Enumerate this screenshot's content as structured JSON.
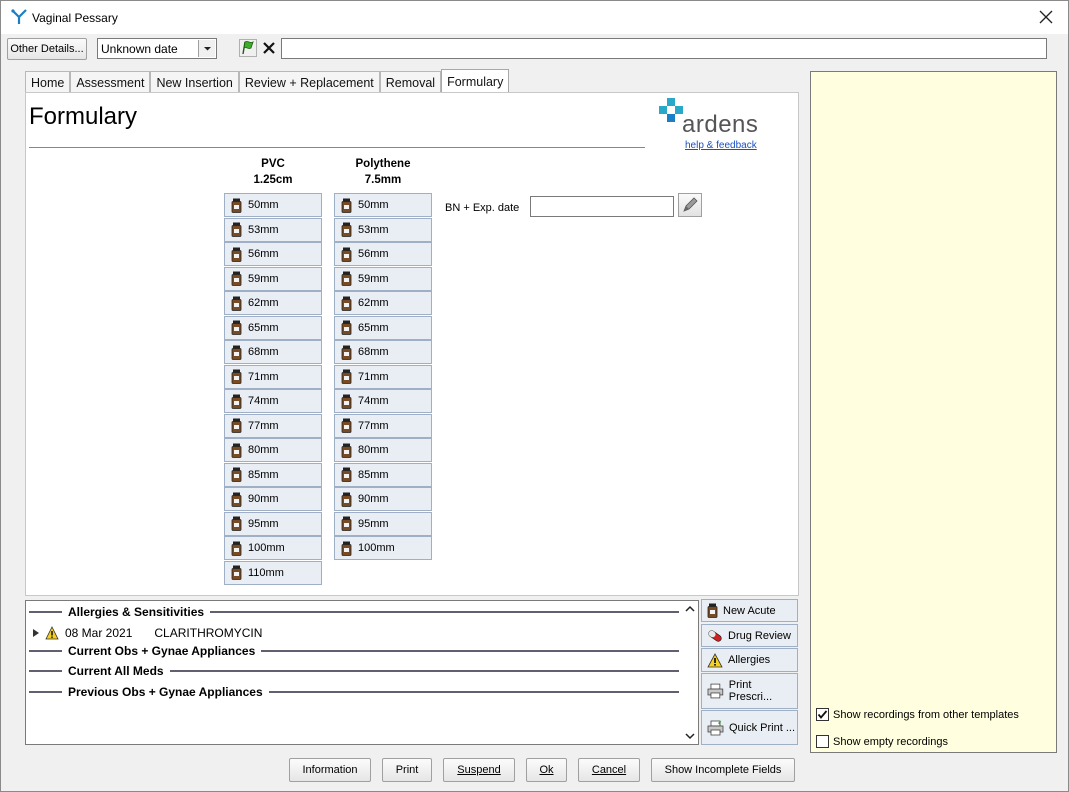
{
  "window": {
    "title": "Vaginal Pessary"
  },
  "toolbar": {
    "other_details_label": "Other Details...",
    "date_value": "Unknown date",
    "note_value": ""
  },
  "tabs": [
    "Home",
    "Assessment",
    "New Insertion",
    "Review + Replacement",
    "Removal",
    "Formulary"
  ],
  "active_tab": "Formulary",
  "page": {
    "title": "Formulary",
    "logo_text": "ardens",
    "help_link": "help & feedback",
    "bn_label": "BN + Exp. date",
    "bn_value": ""
  },
  "pvc": {
    "heading_line1": "PVC",
    "heading_line2": "1.25cm",
    "sizes": [
      "50mm",
      "53mm",
      "56mm",
      "59mm",
      "62mm",
      "65mm",
      "68mm",
      "71mm",
      "74mm",
      "77mm",
      "80mm",
      "85mm",
      "90mm",
      "95mm",
      "100mm",
      "110mm"
    ]
  },
  "polythene": {
    "heading_line1": "Polythene",
    "heading_line2": "7.5mm",
    "sizes": [
      "50mm",
      "53mm",
      "56mm",
      "59mm",
      "62mm",
      "65mm",
      "68mm",
      "71mm",
      "74mm",
      "77mm",
      "80mm",
      "85mm",
      "90mm",
      "95mm",
      "100mm"
    ]
  },
  "summary": {
    "allergies_header": "Allergies & Sensitivities",
    "allergy_date": "08 Mar 2021",
    "allergy_drug": "CLARITHROMYCIN",
    "current_obs_header": "Current Obs + Gynae Appliances",
    "current_meds_header": "Current All Meds",
    "previous_obs_header": "Previous Obs + Gynae Appliances"
  },
  "side_buttons": {
    "new_acute": "New Acute",
    "drug_review": "Drug Review",
    "allergies": "Allergies",
    "print_prescription": "Print Prescri...",
    "quick_print": "Quick Print ..."
  },
  "bottom_buttons": {
    "information": "Information",
    "print": "Print",
    "suspend": "Suspend",
    "ok": "Ok",
    "cancel": "Cancel",
    "show_incomplete": "Show Incomplete Fields"
  },
  "right_panel": {
    "show_other_templates_label": "Show recordings from other templates",
    "show_other_templates_checked": true,
    "show_empty_label": "Show empty recordings",
    "show_empty_checked": false
  },
  "colors": {
    "accent": "#1a7fc4",
    "logo_teal": "#2aa8c8",
    "right_panel_bg": "#ffffe0",
    "button_bg": "#e9eef5"
  }
}
